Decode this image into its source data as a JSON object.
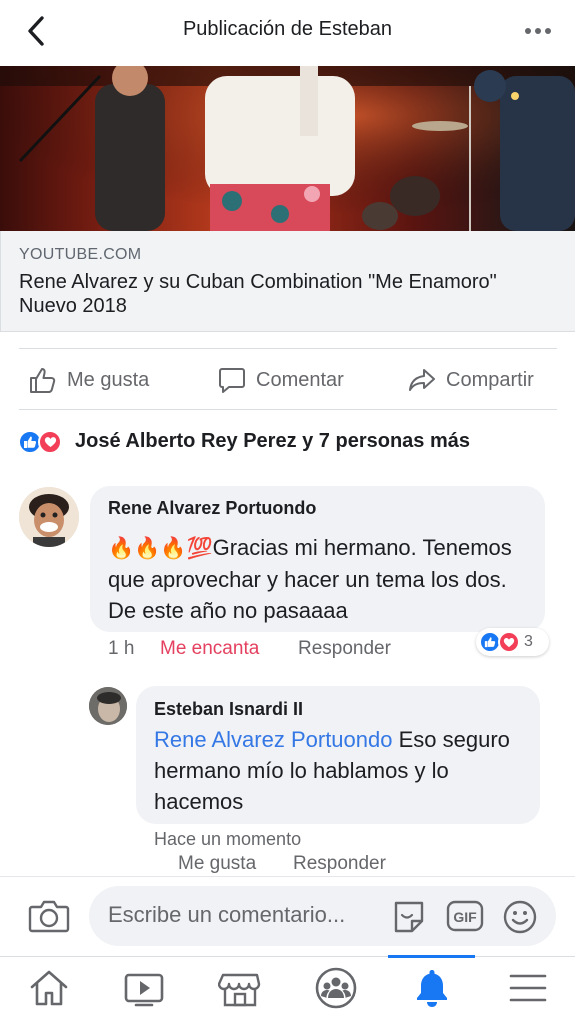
{
  "header": {
    "title": "Publicación de Esteban"
  },
  "link_preview": {
    "domain": "YOUTUBE.COM",
    "title": "Rene Alvarez y su Cuban Combination \"Me Enamoro\" Nuevo 2018"
  },
  "actions": {
    "like": "Me gusta",
    "comment": "Comentar",
    "share": "Compartir"
  },
  "reactions_summary": {
    "text": "José Alberto Rey Perez y 7 personas más"
  },
  "comments": [
    {
      "author": "Rene Alvarez Portuondo",
      "emoji": "🔥🔥🔥💯",
      "text": "Gracias mi hermano. Tenemos que aprovechar y hacer un tema los dos. De este año no pasaaaa",
      "time": "1 h",
      "reaction_label": "Me encanta",
      "reply_label": "Responder",
      "reaction_count": "3",
      "colors": {
        "love": "#e4405f"
      }
    },
    {
      "author": "Esteban Isnardi II",
      "mention": "Rene Alvarez Portuondo",
      "text": " Eso seguro hermano mío lo hablamos y lo hacemos",
      "time": "Hace un momento",
      "like_label": "Me gusta",
      "reply_label": "Responder"
    }
  ],
  "composer": {
    "placeholder": "Escribe un comentario..."
  },
  "tabs": [
    "home-icon",
    "video-icon",
    "marketplace-icon",
    "groups-icon",
    "notifications-icon",
    "menu-icon"
  ],
  "colors": {
    "accent": "#1877f2",
    "link": "#3578e5",
    "text": "#1c1e21",
    "muted": "#65676b"
  }
}
